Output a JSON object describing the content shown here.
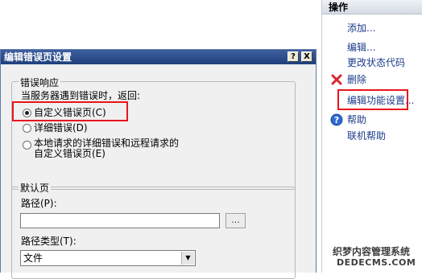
{
  "actions_pane": {
    "title": "操作",
    "items": [
      {
        "label": "添加..."
      },
      {
        "label": "编辑..."
      },
      {
        "label": "更改状态代码"
      },
      {
        "label": "删除",
        "icon": "delete-x-icon"
      },
      {
        "label": "编辑功能设置..."
      },
      {
        "label": "帮助",
        "icon": "help-icon"
      },
      {
        "label": "联机帮助"
      }
    ]
  },
  "dialog": {
    "title": "编辑错误页设置",
    "help_button": "?",
    "close_button": "X",
    "error_response": {
      "legend": "错误响应",
      "prompt": "当服务器遇到错误时，返回:",
      "options": [
        {
          "label": "自定义错误页(C)",
          "selected": true
        },
        {
          "label": "详细错误(D)",
          "selected": false
        },
        {
          "label_line1": "本地请求的详细错误和远程请求的",
          "label_line2": "自定义错误页(E)",
          "selected": false
        }
      ]
    },
    "default_page": {
      "legend": "默认页",
      "path_label": "路径(P):",
      "path_value": "",
      "browse_label": "...",
      "path_type_label": "路径类型(T):",
      "path_type_value": "文件"
    }
  },
  "watermark": {
    "line1": "织梦内容管理系统",
    "line2": "DEDECMS.COM"
  },
  "colors": {
    "highlight": "#e8141c",
    "titlebar": "#1f3f7c",
    "action_link": "#1a3a8a"
  }
}
